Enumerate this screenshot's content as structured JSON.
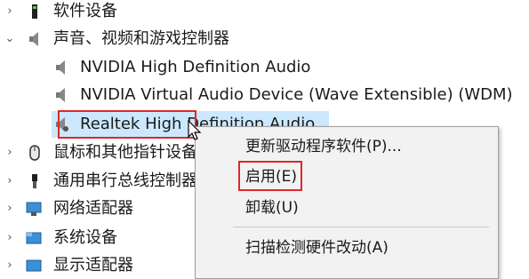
{
  "tree": {
    "software_devices": "软件设备",
    "audio_category": "声音、视频和游戏控制器",
    "audio_devices": [
      "NVIDIA High Definition Audio",
      "NVIDIA Virtual Audio Device (Wave Extensible) (WDM)",
      "Realtek High Definition Audio"
    ],
    "mice": "鼠标和其他指针设备",
    "usb": "通用串行总线控制器",
    "network": "网络适配器",
    "system": "系统设备",
    "display": "显示适配器"
  },
  "context_menu": {
    "update_driver": "更新驱动程序软件(P)...",
    "enable": "启用(E)",
    "uninstall": "卸载(U)",
    "scan": "扫描检测硬件改动(A)"
  },
  "colors": {
    "highlight": "#cce8ff",
    "annotation": "#e0262a"
  }
}
